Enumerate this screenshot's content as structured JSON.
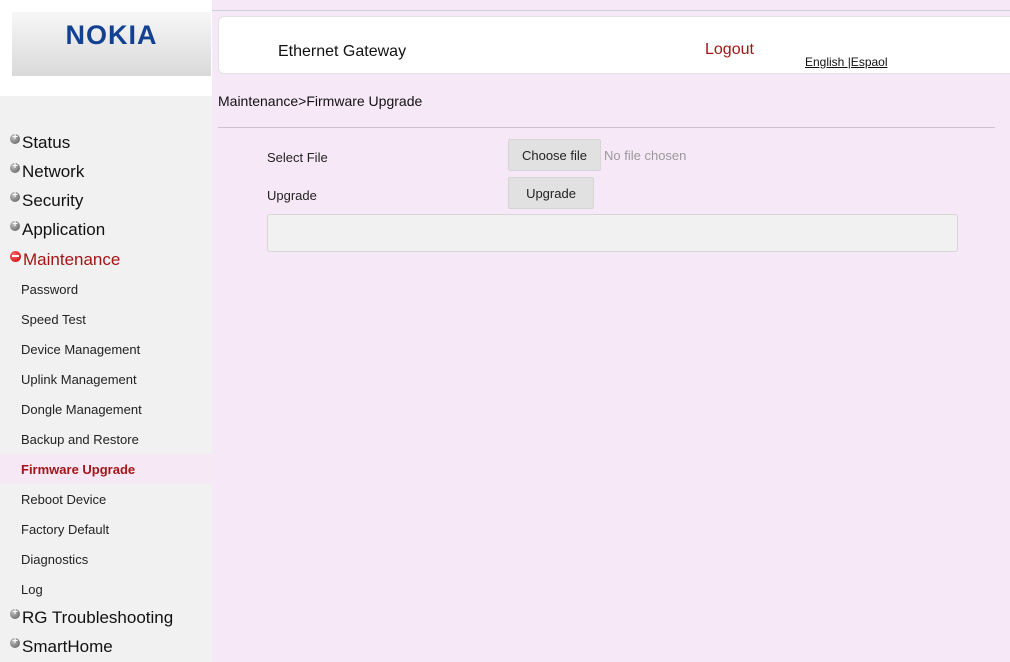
{
  "brand": {
    "logo_text": "NOKIA",
    "logo_color": "#124191"
  },
  "header": {
    "title": "Ethernet Gateway",
    "logout": "Logout",
    "languages": "English |Espaol"
  },
  "sidebar": {
    "menu": [
      {
        "label": "Status",
        "icon": "plus-circle-icon"
      },
      {
        "label": "Network",
        "icon": "plus-circle-icon"
      },
      {
        "label": "Security",
        "icon": "plus-circle-icon"
      },
      {
        "label": "Application",
        "icon": "plus-circle-icon"
      },
      {
        "label": "Maintenance",
        "icon": "minus-circle-icon",
        "expanded": true
      }
    ],
    "maintenance_items": [
      "Password",
      "Speed Test",
      "Device Management",
      "Uplink Management",
      "Dongle Management",
      "Backup and Restore",
      "Firmware Upgrade",
      "Reboot Device",
      "Factory Default",
      "Diagnostics",
      "Log"
    ],
    "active_item": "Firmware Upgrade",
    "menu_after": [
      {
        "label": "RG Troubleshooting",
        "icon": "plus-circle-icon"
      },
      {
        "label": "SmartHome",
        "icon": "plus-circle-icon"
      }
    ]
  },
  "main": {
    "breadcrumb": "Maintenance>Firmware Upgrade",
    "select_file_label": "Select File",
    "choose_file_button": "Choose file",
    "no_file_text": "No file chosen",
    "upgrade_label": "Upgrade",
    "upgrade_button": "Upgrade",
    "status_text": ""
  },
  "colors": {
    "accent_red": "#a31515",
    "content_background": "#f6e8f6",
    "sidebar_background": "#f1f1f1"
  }
}
